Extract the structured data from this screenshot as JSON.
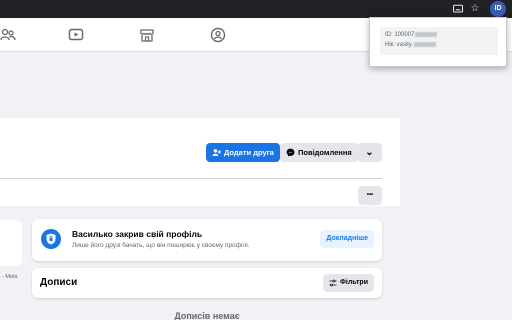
{
  "browser": {
    "avatar_initials": "ID",
    "icons": [
      "cast-icon",
      "star-icon"
    ]
  },
  "popup": {
    "id_label": "ID: 100007",
    "nick_label": "Нік: vasily."
  },
  "nav": {
    "icons": [
      "friends-icon",
      "watch-icon",
      "marketplace-icon",
      "groups-icon"
    ]
  },
  "profile": {
    "add_friend_label": "Додати друга",
    "message_label": "Повідомлення",
    "more_options_label": "⌄",
    "tabs_more_label": "•••"
  },
  "locked": {
    "title": "Василько закрив свій профіль",
    "description": "Лише його друзі бачать, що він поширює у своєму профілі.",
    "more_label": "Докладніше"
  },
  "left": {
    "meta_text": "- Meta"
  },
  "posts": {
    "title": "Дописи",
    "filter_label": "Фільтри",
    "empty_label": "Дописів немає"
  },
  "colors": {
    "primary": "#1b74e4",
    "page_bg": "#f0f2f5",
    "browser_bar": "#202124"
  }
}
